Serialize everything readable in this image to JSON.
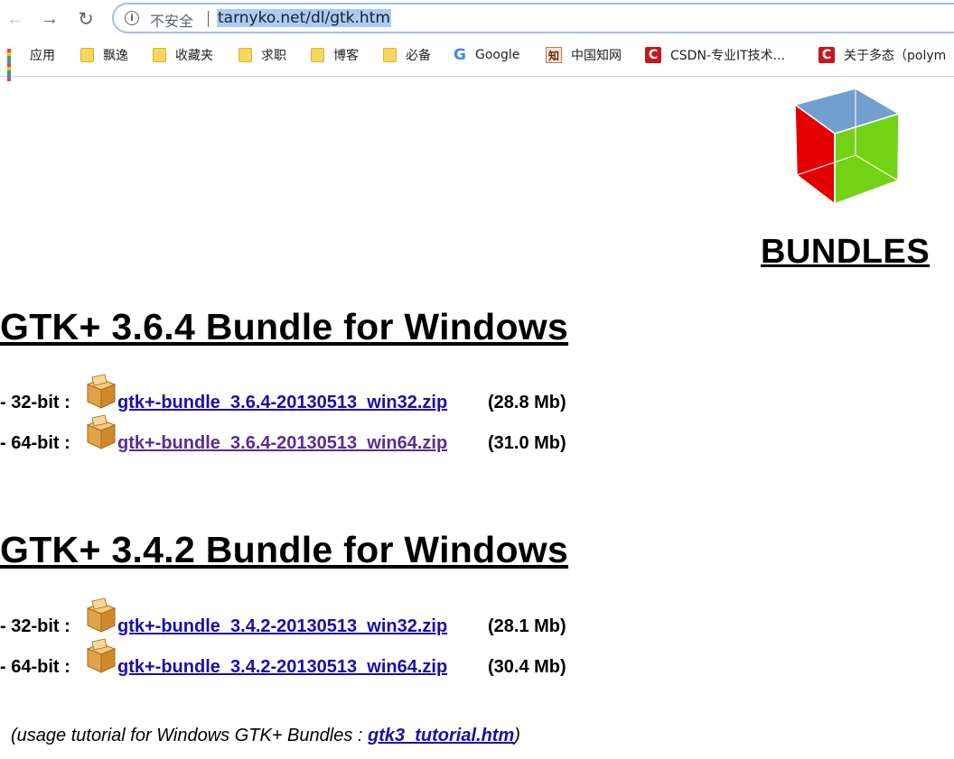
{
  "browser": {
    "security_label": "不安全",
    "url": "tarnyko.net/dl/gtk.htm",
    "bookmarks": [
      {
        "label": "应用",
        "icon": "apps-grid-icon"
      },
      {
        "label": "飘逸",
        "icon": "folder-icon"
      },
      {
        "label": "收藏夹",
        "icon": "folder-icon"
      },
      {
        "label": "求职",
        "icon": "folder-icon"
      },
      {
        "label": "博客",
        "icon": "folder-icon"
      },
      {
        "label": "必备",
        "icon": "folder-icon"
      },
      {
        "label": "Google",
        "icon": "google-icon"
      },
      {
        "label": "中国知网",
        "icon": "cnki-icon"
      },
      {
        "label": "CSDN-专业IT技术...",
        "icon": "csdn-icon"
      },
      {
        "label": "关于多态（polym",
        "icon": "csdn-icon"
      }
    ]
  },
  "page": {
    "bundles_heading": "BUNDLES",
    "sections": [
      {
        "title": "GTK+ 3.6.4 Bundle for Windows",
        "downloads": [
          {
            "arch": "- 32-bit :",
            "file": "gtk+-bundle_3.6.4-20130513_win32.zip",
            "size": "(28.8 Mb)"
          },
          {
            "arch": "- 64-bit :",
            "file": "gtk+-bundle_3.6.4-20130513_win64.zip",
            "size": "(31.0 Mb)"
          }
        ]
      },
      {
        "title": "GTK+ 3.4.2 Bundle for Windows",
        "downloads": [
          {
            "arch": "- 32-bit :",
            "file": "gtk+-bundle_3.4.2-20130513_win32.zip",
            "size": "(28.1 Mb)"
          },
          {
            "arch": "- 64-bit :",
            "file": "gtk+-bundle_3.4.2-20130513_win64.zip",
            "size": "(30.4 Mb)"
          }
        ]
      }
    ],
    "tutorial": {
      "prefix": "(usage tutorial for Windows GTK+ Bundles : ",
      "link": "gtk3_tutorial.htm",
      "suffix": ")"
    }
  },
  "colors": {
    "link": "#1a0dab",
    "visited_link": "#5a2d91",
    "url_highlight": "#a9ccf4"
  }
}
